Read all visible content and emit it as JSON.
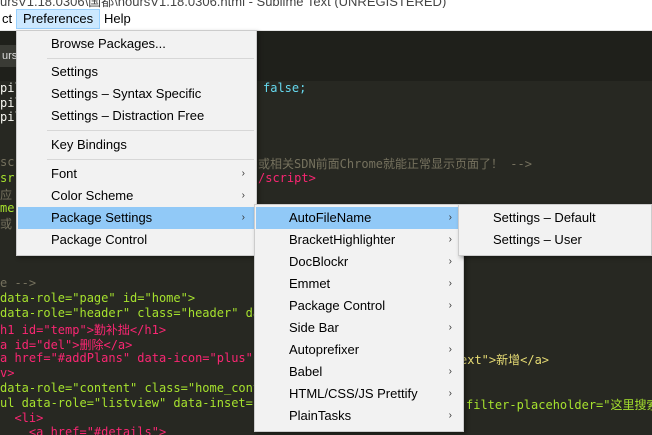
{
  "window": {
    "title": "ursV1.18.0306\\国都\\hoursV1.18.0306.html - Sublime Text (UNREGISTERED)"
  },
  "menubar": {
    "items": [
      "ct",
      "Preferences",
      "Help"
    ]
  },
  "tab": {
    "label": "ursV"
  },
  "editor": {
    "lines": [
      {
        "left": "pil",
        "right": "false;"
      },
      {
        "left": "pil",
        "right": ""
      },
      {
        "left": "pil",
        "right": ""
      },
      {
        "left": "sc",
        "right": "或相关SDN前面Chrome就能正常显示页面了！ -->"
      },
      {
        "left": "sr",
        "right": "/script>"
      },
      {
        "left": "应",
        "right": ""
      },
      {
        "left": "me",
        "right": ""
      },
      {
        "left": "或",
        "right": ""
      },
      {
        "left": "e -->",
        "right": ""
      },
      {
        "left": "data-role=\"page\" id=\"home\">",
        "right": ""
      },
      {
        "left": "data-role=\"header\" class=\"header\" da",
        "right": ""
      },
      {
        "left": "h1 id=\"temp\">勤补拙</h1>",
        "right": ""
      },
      {
        "left": "a id=\"del\">删除</a>",
        "right": ""
      },
      {
        "left": "a href=\"#addPlans\" data-icon=\"plus\"",
        "right": "ext\">新增</a>"
      },
      {
        "left": "v>",
        "right": ""
      },
      {
        "left": "data-role=\"content\" class=\"home_cont",
        "right": ""
      },
      {
        "left": "ul data-role=\"listview\" data-inset=",
        "right": "filter-placeholder=\"这里搜索"
      },
      {
        "left": "  <li>",
        "right": ""
      },
      {
        "left": "    <a href=\"#details\">",
        "right": ""
      }
    ]
  },
  "preferences_menu": {
    "items": [
      {
        "label": "Browse Packages...",
        "submenu": false
      },
      {
        "label": "Settings",
        "submenu": false
      },
      {
        "label": "Settings – Syntax Specific",
        "submenu": false
      },
      {
        "label": "Settings – Distraction Free",
        "submenu": false
      },
      {
        "label": "Key Bindings",
        "submenu": false
      },
      {
        "label": "Font",
        "submenu": true
      },
      {
        "label": "Color Scheme",
        "submenu": true
      },
      {
        "label": "Package Settings",
        "submenu": true
      },
      {
        "label": "Package Control",
        "submenu": false
      }
    ],
    "highlighted": "Package Settings"
  },
  "package_settings_menu": {
    "items": [
      "AutoFileName",
      "BracketHighlighter",
      "DocBlockr",
      "Emmet",
      "Package Control",
      "Side Bar",
      "Autoprefixer",
      "Babel",
      "HTML/CSS/JS Prettify",
      "PlainTasks"
    ],
    "highlighted": "AutoFileName"
  },
  "autofilename_menu": {
    "items": [
      "Settings – Default",
      "Settings – User"
    ]
  },
  "icons": {
    "submenu_arrow": "chevron-right-icon",
    "submenu_arrow_glyph": "›"
  }
}
